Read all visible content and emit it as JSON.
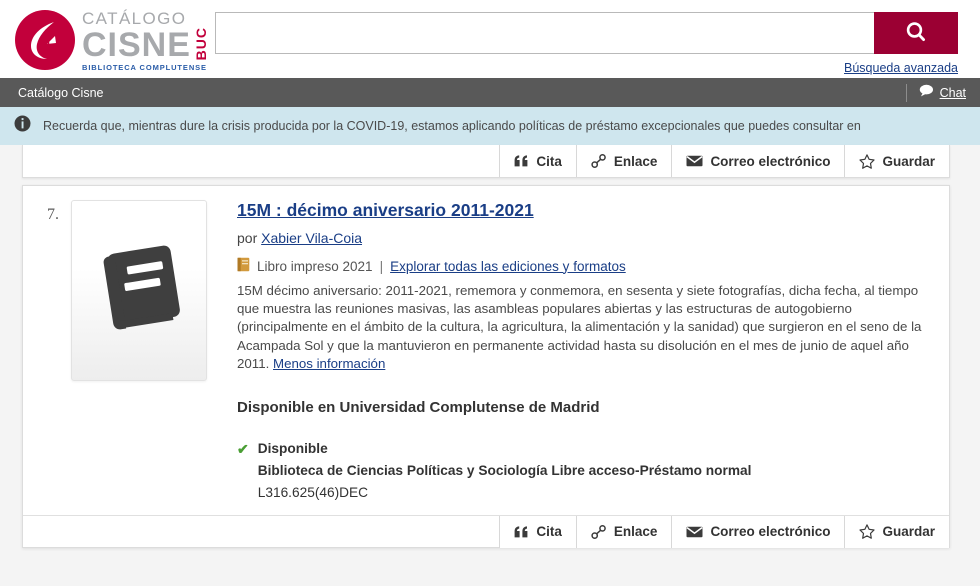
{
  "header": {
    "logo": {
      "catalogo": "CATÁLOGO",
      "cisne": "CISNE",
      "buc": "BUC",
      "subtitle": "BIBLIOTECA COMPLUTENSE",
      "mark_icon": "swan-logo-icon",
      "colors": {
        "red": "#c2003b",
        "gray": "#a7a9ac",
        "blue": "#2a5ca8"
      }
    },
    "search": {
      "value": "",
      "placeholder": "",
      "button_icon": "search-icon",
      "button_color": "#9b0033",
      "advanced_label": "Búsqueda avanzada"
    }
  },
  "navbar": {
    "title": "Catálogo Cisne",
    "chat_label": "Chat",
    "chat_icon": "chat-bubble-icon",
    "background": "#595959"
  },
  "notice": {
    "icon": "info-circle-icon",
    "text": "Recuerda que, mientras dure la crisis producida por la COVID-19, estamos aplicando políticas de préstamo excepcionales que puedes consultar en",
    "background": "#cfe6ee"
  },
  "toolbar": {
    "buttons": [
      {
        "label": "Cita",
        "icon": "quote-icon",
        "name": "cite-button"
      },
      {
        "label": "Enlace",
        "icon": "link-icon",
        "name": "link-button"
      },
      {
        "label": "Correo electrónico",
        "icon": "envelope-icon",
        "name": "email-button"
      },
      {
        "label": "Guardar",
        "icon": "star-icon",
        "name": "save-button"
      }
    ]
  },
  "result": {
    "rank": "7.",
    "thumbnail_icon": "book-icon",
    "title": "15M : décimo aniversario 2011-2021",
    "author_prefix": "por",
    "author": "Xabier Vila-Coia",
    "format_icon": "small-book-icon",
    "format": "Libro impreso 2021",
    "separator": "|",
    "editions_link": "Explorar todas las ediciones y formatos",
    "summary": "15M décimo aniversario: 2011-2021, rememora y conmemora, en sesenta y siete fotografías, dicha fecha, al tiempo que muestra las reuniones masivas, las asambleas populares abiertas y las estructuras de autogobierno (principalmente en el ámbito de la cultura, la agricultura, la alimentación y la sanidad) que surgieron en el seno de la Acampada Sol y que la mantuvieron en permanente actividad hasta su disolución en el mes de junio de aquel año 2011.",
    "less_info_link": "Menos información",
    "availability_heading": "Disponible en Universidad Complutense de Madrid",
    "holding": {
      "status": "Disponible",
      "status_icon": "check-icon",
      "status_color": "#4a9e34",
      "location": "Biblioteca de Ciencias Políticas y Sociología Libre acceso-Préstamo normal",
      "call_number": "L316.625(46)DEC"
    }
  }
}
